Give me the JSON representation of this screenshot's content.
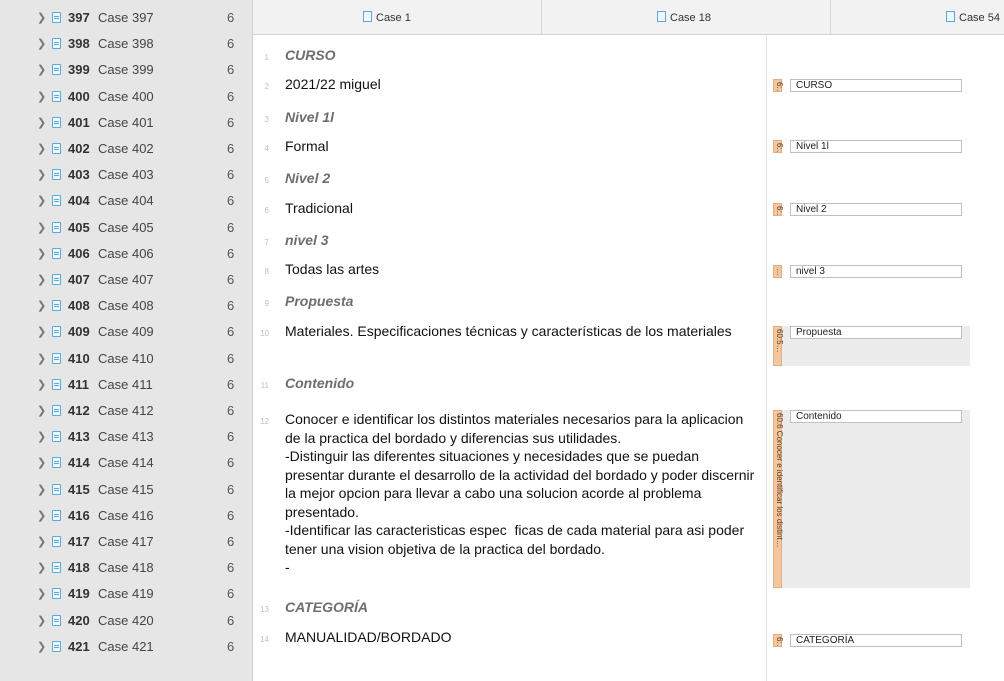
{
  "sidebar": {
    "rows": [
      {
        "num": "397",
        "name": "Case 397",
        "count": "6"
      },
      {
        "num": "398",
        "name": "Case 398",
        "count": "6"
      },
      {
        "num": "399",
        "name": "Case 399",
        "count": "6"
      },
      {
        "num": "400",
        "name": "Case 400",
        "count": "6"
      },
      {
        "num": "401",
        "name": "Case 401",
        "count": "6"
      },
      {
        "num": "402",
        "name": "Case 402",
        "count": "6"
      },
      {
        "num": "403",
        "name": "Case 403",
        "count": "6"
      },
      {
        "num": "404",
        "name": "Case 404",
        "count": "6"
      },
      {
        "num": "405",
        "name": "Case 405",
        "count": "6"
      },
      {
        "num": "406",
        "name": "Case 406",
        "count": "6"
      },
      {
        "num": "407",
        "name": "Case 407",
        "count": "6"
      },
      {
        "num": "408",
        "name": "Case 408",
        "count": "6"
      },
      {
        "num": "409",
        "name": "Case 409",
        "count": "6"
      },
      {
        "num": "410",
        "name": "Case 410",
        "count": "6"
      },
      {
        "num": "411",
        "name": "Case 411",
        "count": "6"
      },
      {
        "num": "412",
        "name": "Case 412",
        "count": "6"
      },
      {
        "num": "413",
        "name": "Case 413",
        "count": "6"
      },
      {
        "num": "414",
        "name": "Case 414",
        "count": "6"
      },
      {
        "num": "415",
        "name": "Case 415",
        "count": "6"
      },
      {
        "num": "416",
        "name": "Case 416",
        "count": "6"
      },
      {
        "num": "417",
        "name": "Case 417",
        "count": "6"
      },
      {
        "num": "418",
        "name": "Case 418",
        "count": "6"
      },
      {
        "num": "419",
        "name": "Case 419",
        "count": "6"
      },
      {
        "num": "420",
        "name": "Case 420",
        "count": "6"
      },
      {
        "num": "421",
        "name": "Case 421",
        "count": "6"
      }
    ]
  },
  "tabs": [
    {
      "label": "Case 1"
    },
    {
      "label": "Case 18"
    },
    {
      "label": "Case 54"
    }
  ],
  "document": {
    "lines": [
      {
        "n": "1",
        "text": "CURSO",
        "head": true
      },
      {
        "n": "2",
        "text": "2021/22 miguel",
        "head": false
      },
      {
        "n": "3",
        "text": "Nivel 1l",
        "head": true
      },
      {
        "n": "4",
        "text": "Formal",
        "head": false
      },
      {
        "n": "5",
        "text": "Nivel 2",
        "head": true
      },
      {
        "n": "6",
        "text": "Tradicional",
        "head": false
      },
      {
        "n": "7",
        "text": "nivel 3",
        "head": true
      },
      {
        "n": "8",
        "text": "Todas las artes",
        "head": false
      },
      {
        "n": "9",
        "text": "Propuesta",
        "head": true
      },
      {
        "n": "10",
        "text": "Materiales. Especificaciones técnicas y características de los materiales",
        "head": false
      },
      {
        "n": "11",
        "text": "Contenido",
        "head": true
      },
      {
        "n": "12",
        "text": "Conocer e identificar los distintos materiales necesarios para la aplicacion de la practica del bordado y diferencias sus utilidades.\n-Distinguir las diferentes situaciones y necesidades que se puedan presentar durante el desarrollo de la actividad del bordado y poder discernir la mejor opcion para llevar a cabo una solucion acorde al problema presentado.\n-Identificar las caracteristicas espec  ficas de cada material para asi poder tener una vision objetiva de la practica del bordado.\n-",
        "head": false
      },
      {
        "n": "13",
        "text": "CATEGORÍA",
        "head": true
      },
      {
        "n": "14",
        "text": "MANUALIDAD/BORDADO",
        "head": false
      }
    ]
  },
  "codes": [
    {
      "label": "CURSO",
      "bar": "6:…"
    },
    {
      "label": "Nivel 1l",
      "bar": "6:…"
    },
    {
      "label": "Nivel 2",
      "bar": "6:…"
    },
    {
      "label": "nivel 3",
      "bar": "…"
    },
    {
      "label": "Propuesta",
      "bar": "60:5…"
    },
    {
      "label": "Contenido",
      "bar": "60:6 Conocer e identificar los distint…"
    },
    {
      "label": "CATEGORÍA",
      "bar": "6:…"
    }
  ]
}
